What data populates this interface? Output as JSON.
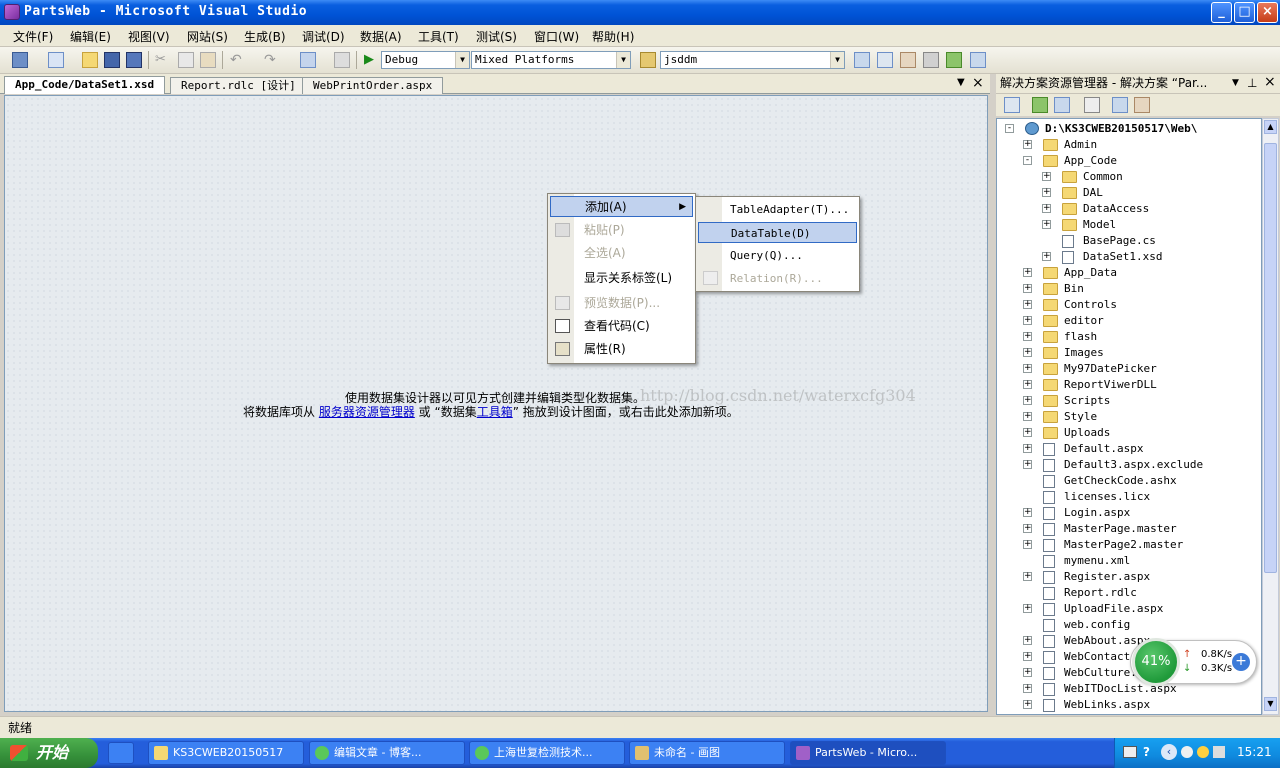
{
  "window": {
    "title": "PartsWeb - Microsoft Visual Studio",
    "minimize": "_",
    "maximize": "□",
    "close": "×"
  },
  "menubar": [
    "文件(F)",
    "编辑(E)",
    "视图(V)",
    "网站(S)",
    "生成(B)",
    "调试(D)",
    "数据(A)",
    "工具(T)",
    "测试(S)",
    "窗口(W)",
    "帮助(H)"
  ],
  "toolbar": {
    "config": "Debug",
    "platform": "Mixed Platforms",
    "find": "jsddm"
  },
  "tabs": [
    {
      "label": "App_Code/DataSet1.xsd",
      "active": true
    },
    {
      "label": "Report.rdlc [设计]",
      "active": false
    },
    {
      "label": "WebPrintOrder.aspx",
      "active": false
    }
  ],
  "designer": {
    "hint_line1": "使用数据集设计器以可见方式创建并编辑类型化数据集。",
    "hint_line2_prefix": "将数据库项从 ",
    "hint_link1": "服务器资源管理器",
    "hint_mid": " 或 “数据集",
    "hint_link2": "工具箱",
    "hint_suffix": "” 拖放到设计图面，或右击此处添加新项。",
    "watermark": "http://blog.csdn.net/waterxcfg304"
  },
  "context_menu": [
    {
      "label": "添加(A)",
      "enabled": true,
      "highlighted": true,
      "submenu": true
    },
    {
      "label": "粘贴(P)",
      "enabled": false
    },
    {
      "label": "全选(A)",
      "enabled": false
    },
    {
      "label": "显示关系标签(L)",
      "enabled": true
    },
    {
      "label": "预览数据(P)...",
      "enabled": false
    },
    {
      "label": "查看代码(C)",
      "enabled": true
    },
    {
      "label": "属性(R)",
      "enabled": true
    }
  ],
  "submenu": [
    {
      "label": "TableAdapter(T)...",
      "enabled": true
    },
    {
      "label": "DataTable(D)",
      "enabled": true,
      "highlighted": true
    },
    {
      "label": "Query(Q)...",
      "enabled": true
    },
    {
      "label": "Relation(R)...",
      "enabled": false
    }
  ],
  "solution_explorer": {
    "title": "解决方案资源管理器 - 解决方案 “Par...",
    "root": "D:\\KS3CWEB20150517\\Web\\",
    "nodes": [
      {
        "label": "Admin",
        "kind": "folder",
        "depth": 1,
        "exp": "+"
      },
      {
        "label": "App_Code",
        "kind": "folder-open",
        "depth": 1,
        "exp": "-"
      },
      {
        "label": "Common",
        "kind": "folder",
        "depth": 2,
        "exp": "+"
      },
      {
        "label": "DAL",
        "kind": "folder",
        "depth": 2,
        "exp": "+"
      },
      {
        "label": "DataAccess",
        "kind": "folder",
        "depth": 2,
        "exp": "+"
      },
      {
        "label": "Model",
        "kind": "folder",
        "depth": 2,
        "exp": "+"
      },
      {
        "label": "BasePage.cs",
        "kind": "file",
        "depth": 2,
        "exp": ""
      },
      {
        "label": "DataSet1.xsd",
        "kind": "file",
        "depth": 2,
        "exp": "+"
      },
      {
        "label": "App_Data",
        "kind": "folder",
        "depth": 1,
        "exp": "+"
      },
      {
        "label": "Bin",
        "kind": "folder",
        "depth": 1,
        "exp": "+"
      },
      {
        "label": "Controls",
        "kind": "folder",
        "depth": 1,
        "exp": "+"
      },
      {
        "label": "editor",
        "kind": "folder",
        "depth": 1,
        "exp": "+"
      },
      {
        "label": "flash",
        "kind": "folder",
        "depth": 1,
        "exp": "+"
      },
      {
        "label": "Images",
        "kind": "folder",
        "depth": 1,
        "exp": "+"
      },
      {
        "label": "My97DatePicker",
        "kind": "folder",
        "depth": 1,
        "exp": "+"
      },
      {
        "label": "ReportViwerDLL",
        "kind": "folder",
        "depth": 1,
        "exp": "+"
      },
      {
        "label": "Scripts",
        "kind": "folder",
        "depth": 1,
        "exp": "+"
      },
      {
        "label": "Style",
        "kind": "folder",
        "depth": 1,
        "exp": "+"
      },
      {
        "label": "Uploads",
        "kind": "folder",
        "depth": 1,
        "exp": "+"
      },
      {
        "label": "Default.aspx",
        "kind": "file",
        "depth": 1,
        "exp": "+"
      },
      {
        "label": "Default3.aspx.exclude",
        "kind": "file",
        "depth": 1,
        "exp": "+"
      },
      {
        "label": "GetCheckCode.ashx",
        "kind": "file",
        "depth": 1,
        "exp": ""
      },
      {
        "label": "licenses.licx",
        "kind": "file",
        "depth": 1,
        "exp": ""
      },
      {
        "label": "Login.aspx",
        "kind": "file",
        "depth": 1,
        "exp": "+"
      },
      {
        "label": "MasterPage.master",
        "kind": "file",
        "depth": 1,
        "exp": "+"
      },
      {
        "label": "MasterPage2.master",
        "kind": "file",
        "depth": 1,
        "exp": "+"
      },
      {
        "label": "mymenu.xml",
        "kind": "file",
        "depth": 1,
        "exp": ""
      },
      {
        "label": "Register.aspx",
        "kind": "file",
        "depth": 1,
        "exp": "+"
      },
      {
        "label": "Report.rdlc",
        "kind": "file",
        "depth": 1,
        "exp": ""
      },
      {
        "label": "UploadFile.aspx",
        "kind": "file",
        "depth": 1,
        "exp": "+"
      },
      {
        "label": "web.config",
        "kind": "file",
        "depth": 1,
        "exp": ""
      },
      {
        "label": "WebAbout.aspx",
        "kind": "file",
        "depth": 1,
        "exp": "+"
      },
      {
        "label": "WebContact.",
        "kind": "file",
        "depth": 1,
        "exp": "+"
      },
      {
        "label": "WebCulture.",
        "kind": "file",
        "depth": 1,
        "exp": "+"
      },
      {
        "label": "WebITDocList.aspx",
        "kind": "file",
        "depth": 1,
        "exp": "+"
      },
      {
        "label": "WebLinks.aspx",
        "kind": "file",
        "depth": 1,
        "exp": "+"
      }
    ]
  },
  "net_widget": {
    "percent": "41%",
    "upload": "0.8K/s",
    "download": "0.3K/s"
  },
  "statusbar": {
    "text": "就绪"
  },
  "taskbar": {
    "start": "开始",
    "items": [
      {
        "label": "KS3CWEB20150517",
        "active": false
      },
      {
        "label": "编辑文章 - 博客...",
        "active": false
      },
      {
        "label": "上海世复检测技术...",
        "active": false
      },
      {
        "label": "未命名 - 画图",
        "active": false
      },
      {
        "label": "PartsWeb - Micro...",
        "active": true
      }
    ],
    "clock": "15:21"
  },
  "colors": {
    "titlebar": "#0053d6",
    "menu_highlight": "#c1d2ee",
    "taskbar": "#245edb",
    "link": "#0000cc"
  }
}
